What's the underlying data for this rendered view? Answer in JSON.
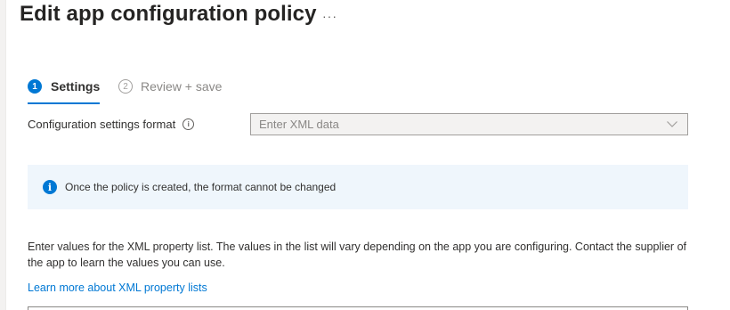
{
  "header": {
    "title": "Edit app configuration policy",
    "more_label": "···"
  },
  "wizard": {
    "steps": [
      {
        "number": "1",
        "label": "Settings",
        "active": true
      },
      {
        "number": "2",
        "label": "Review + save",
        "active": false
      }
    ]
  },
  "form": {
    "format_label": "Configuration settings format",
    "format_info_icon": "info-icon",
    "format_value": "Enter XML data",
    "format_disabled": true
  },
  "banner": {
    "icon": "info-icon",
    "text": "Once the policy is created, the format cannot be changed"
  },
  "content": {
    "description": "Enter values for the XML property list. The values in the list will vary depending on the app you are configuring. Contact the supplier of the app to learn the values you can use.",
    "learn_more_link": "Learn more about XML property lists"
  },
  "colors": {
    "accent": "#0078d4",
    "banner_bg": "#eff6fc",
    "disabled_field_bg": "#f3f2f1"
  }
}
